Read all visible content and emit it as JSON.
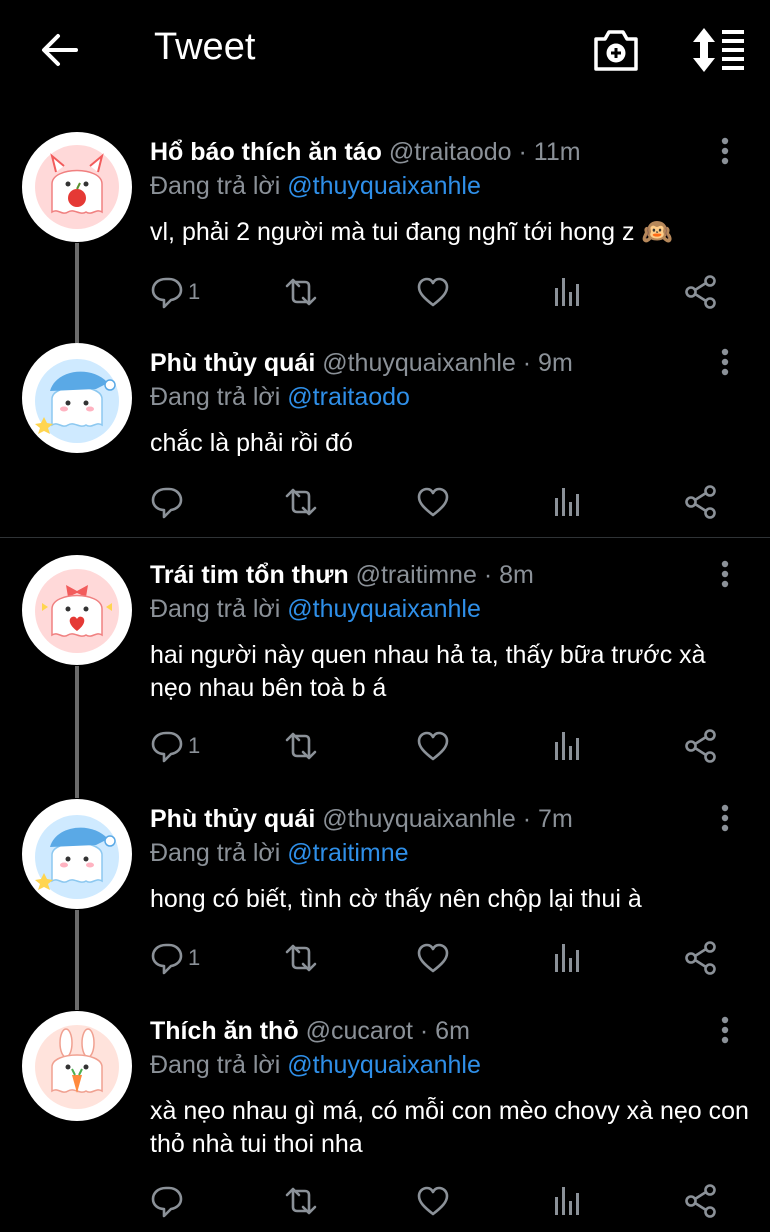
{
  "header": {
    "title": "Tweet"
  },
  "tweets": [
    {
      "name": "Hổ báo thích ăn táo",
      "handle": "@traitaodo",
      "time": "· 11m",
      "reply_prefix": "Đang trả lời",
      "reply_to": "@thuyquaixanhle",
      "text": "vl, phải 2 người mà tui đang nghĩ tới hong z 🙉",
      "reply_count": "1",
      "avatar_icon": "ghost-apple-avatar",
      "accent": "#f25c5c"
    },
    {
      "name": "Phù thủy quái",
      "handle": "@thuyquaixanhle",
      "time": "· 9m",
      "reply_prefix": "Đang trả lời",
      "reply_to": "@traitaodo",
      "text": "chắc là phải rồi đó",
      "reply_count": "",
      "avatar_icon": "ghost-nightcap-avatar",
      "accent": "#5bb4f0"
    },
    {
      "name": "Trái tim tổn thưn",
      "handle": "@traitimne",
      "time": "· 8m",
      "reply_prefix": "Đang trả lời",
      "reply_to": "@thuyquaixanhle",
      "text": "hai người này quen nhau hả ta, thấy bữa trước xà nẹo nhau bên toà b á",
      "reply_count": "1",
      "avatar_icon": "ghost-heart-avatar",
      "accent": "#f25c5c"
    },
    {
      "name": "Phù thủy quái",
      "handle": "@thuyquaixanhle",
      "time": "· 7m",
      "reply_prefix": "Đang trả lời",
      "reply_to": "@traitimne",
      "text": "hong có biết, tình cờ thấy nên chộp lại thui à",
      "reply_count": "1",
      "avatar_icon": "ghost-nightcap-avatar",
      "accent": "#5bb4f0"
    },
    {
      "name": "Thích ăn thỏ",
      "handle": "@cucarot",
      "time": "· 6m",
      "reply_prefix": "Đang trả lời",
      "reply_to": "@thuyquaixanhle",
      "text": "xà nẹo nhau gì má, có mỗi con mèo chovy xà nẹo con thỏ nhà tui thoi nha",
      "reply_count": "",
      "avatar_icon": "bunny-carrot-avatar",
      "accent": "#f08a7a"
    }
  ],
  "colors": {
    "background": "#000000",
    "text": "#ffffff",
    "muted": "#8b9198",
    "link": "#2f8fe8",
    "thread_line": "#6b6b6b"
  }
}
